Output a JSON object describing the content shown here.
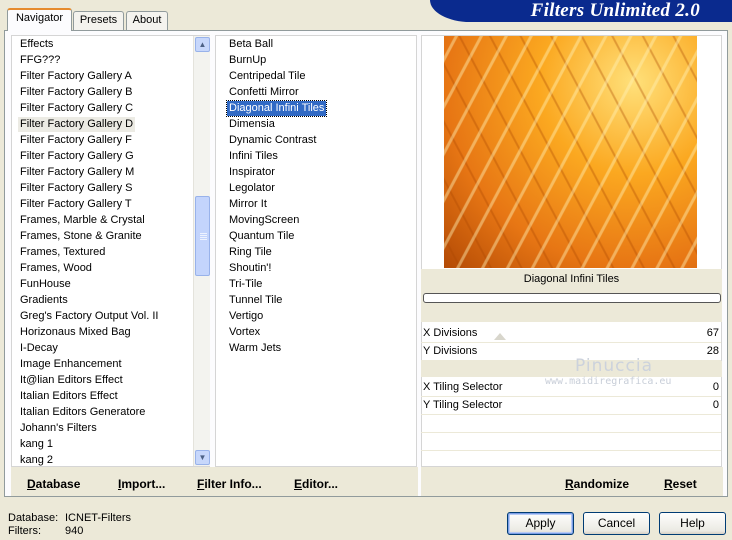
{
  "app": {
    "title": "Filters Unlimited 2.0"
  },
  "tabs": [
    {
      "label": "Navigator"
    },
    {
      "label": "Presets"
    },
    {
      "label": "About"
    }
  ],
  "categories": {
    "items": [
      "Effects",
      "FFG???",
      "Filter Factory Gallery A",
      "Filter Factory Gallery B",
      "Filter Factory Gallery C",
      "Filter Factory Gallery D",
      "Filter Factory Gallery F",
      "Filter Factory Gallery G",
      "Filter Factory Gallery M",
      "Filter Factory Gallery S",
      "Filter Factory Gallery T",
      "Frames, Marble & Crystal",
      "Frames, Stone & Granite",
      "Frames, Textured",
      "Frames, Wood",
      "FunHouse",
      "Gradients",
      "Greg's Factory Output Vol. II",
      "Horizonaus Mixed Bag",
      "I-Decay",
      "Image Enhancement",
      "It@lian Editors Effect",
      "Italian Editors Effect",
      "Italian Editors Generatore",
      "Johann's Filters",
      "kang 1",
      "kang 2"
    ],
    "selected": "Filter Factory Gallery D"
  },
  "filters": {
    "items": [
      "Beta Ball",
      "BurnUp",
      "Centripedal Tile",
      "Confetti Mirror",
      "Diagonal Infini Tiles",
      "Dimensia",
      "Dynamic Contrast",
      "Infini Tiles",
      "Inspirator",
      "Legolator",
      "Mirror It",
      "MovingScreen",
      "Quantum Tile",
      "Ring Tile",
      "Shoutin'!",
      "Tri-Tile",
      "Tunnel Tile",
      "Vertigo",
      "Vortex",
      "Warm Jets"
    ],
    "selected": "Diagonal Infini Tiles"
  },
  "preview": {
    "filter_name": "Diagonal Infini Tiles",
    "progress": 0
  },
  "params": [
    {
      "label": "X Divisions",
      "value": "67"
    },
    {
      "label": "Y Divisions",
      "value": "28"
    },
    {
      "label": "X Tiling Selector",
      "value": "0"
    },
    {
      "label": "Y Tiling Selector",
      "value": "0"
    }
  ],
  "watermark": {
    "line1": "Pinuccia",
    "line2": "www.maidiregrafica.eu"
  },
  "bottom_bar": {
    "database_u": "D",
    "database_rest": "atabase",
    "import_u": "I",
    "import_rest": "mport...",
    "filter_info_u": "F",
    "filter_info_rest": "ilter Info...",
    "editor_u": "E",
    "editor_rest": "ditor...",
    "randomize_u": "R",
    "randomize_rest": "andomize",
    "reset_u": "R",
    "reset_rest": "eset"
  },
  "status": {
    "database_label": "Database:",
    "database_value": "ICNET-Filters",
    "filters_label": "Filters:",
    "filters_value": "940"
  },
  "buttons": {
    "apply": "Apply",
    "cancel": "Cancel",
    "help": "Help"
  },
  "colors": {
    "banner": "#0a2a8e",
    "selection": "#316ac5",
    "tab_accent": "#e68b2c",
    "dialog_bg": "#ece9d8",
    "preview_warm": "#fba820"
  }
}
